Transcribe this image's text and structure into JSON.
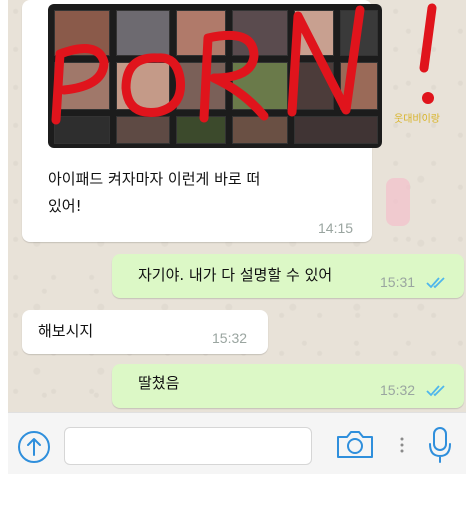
{
  "messages": [
    {
      "direction": "incoming",
      "text_line1": "아이패드 켜자마자 이런게 바로 떠",
      "text_line2": "있어!",
      "time": "14:15",
      "has_image": true,
      "image_overlay_text": "PORN!"
    },
    {
      "direction": "outgoing",
      "text": "자기야. 내가 다 설명할 수 있어",
      "time": "15:31",
      "status": "read"
    },
    {
      "direction": "incoming",
      "text": "해보시지",
      "time": "15:32"
    },
    {
      "direction": "outgoing",
      "text": "딸쳤음",
      "time": "15:32",
      "status": "read"
    }
  ],
  "watermark": "웃대비이랑",
  "input_bar": {
    "placeholder": "",
    "icons": [
      "upload-arrow-icon",
      "camera-icon",
      "more-dots-icon",
      "microphone-icon"
    ]
  },
  "colors": {
    "incoming_bubble": "#ffffff",
    "outgoing_bubble": "#dcf8c6",
    "read_ticks": "#4fb6ec",
    "scrawl_red": "#e0141c",
    "icon_blue": "#2f8fdc",
    "chat_background": "#e8e2d8"
  }
}
